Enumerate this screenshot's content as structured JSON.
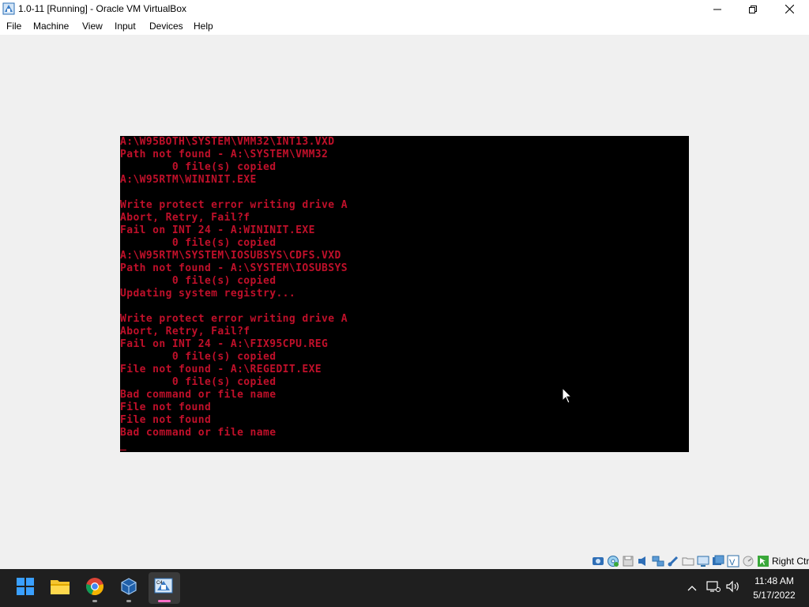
{
  "window": {
    "title": "1.0-11 [Running] - Oracle VM VirtualBox",
    "minimize_icon": "minimize-icon",
    "maximize_icon": "restore-icon",
    "close_icon": "close-icon"
  },
  "menu": {
    "items": [
      "File",
      "Machine",
      "View",
      "Input",
      "Devices",
      "Help"
    ]
  },
  "terminal": {
    "text_color": "#c0102a",
    "background": "#000000",
    "lines": [
      "A:\\W95BOTH\\SYSTEM\\VMM32\\INT13.VXD",
      "Path not found - A:\\SYSTEM\\VMM32",
      "        0 file(s) copied",
      "A:\\W95RTM\\WININIT.EXE",
      "",
      "Write protect error writing drive A",
      "Abort, Retry, Fail?f",
      "Fail on INT 24 - A:WININIT.EXE",
      "        0 file(s) copied",
      "A:\\W95RTM\\SYSTEM\\IOSUBSYS\\CDFS.VXD",
      "Path not found - A:\\SYSTEM\\IOSUBSYS",
      "        0 file(s) copied",
      "Updating system registry...",
      "",
      "Write protect error writing drive A",
      "Abort, Retry, Fail?f",
      "Fail on INT 24 - A:\\FIX95CPU.REG",
      "        0 file(s) copied",
      "File not found - A:\\REGEDIT.EXE",
      "        0 file(s) copied",
      "Bad command or file name",
      "File not found",
      "File not found",
      "Bad command or file name"
    ],
    "cursor": "_"
  },
  "statusbar": {
    "icons": [
      "hard-disk-icon",
      "optical-drive-icon",
      "floppy-icon",
      "audio-icon",
      "network-icon",
      "usb-icon",
      "shared-folders-icon",
      "display-icon",
      "video-capture-icon",
      "recording-icon",
      "virtualization-icon",
      "mouse-integration-icon",
      "keyboard-icon"
    ],
    "host_key": "Right Ctrl"
  },
  "taskbar": {
    "apps": [
      "start-icon",
      "file-explorer-icon",
      "chrome-icon",
      "virtualbox-manager-icon",
      "virtualbox-vm-icon"
    ],
    "clock_time": "11:48 AM",
    "clock_date": "5/17/2022",
    "accent": "#ff6ec7"
  }
}
